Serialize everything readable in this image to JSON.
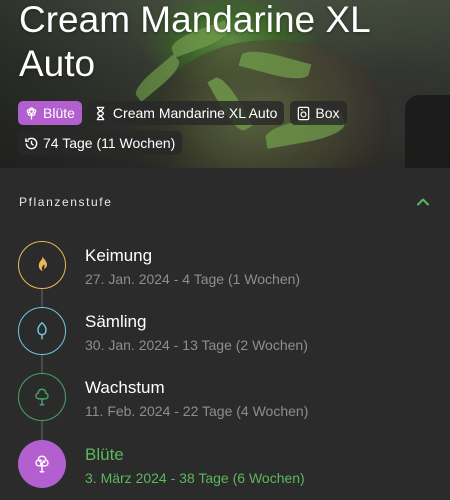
{
  "plant": {
    "title": "Cream Mandarine XL Auto",
    "chips": [
      {
        "label": "Blüte",
        "icon": "flower-icon",
        "accent": true
      },
      {
        "label": "Cream Mandarine XL Auto",
        "icon": "hourglass-icon",
        "accent": false
      },
      {
        "label": "Box",
        "icon": "box-icon",
        "accent": false
      },
      {
        "label": "74 Tage (11 Wochen)",
        "icon": "history-icon",
        "accent": false
      }
    ]
  },
  "stages_panel": {
    "title": "Pflanzenstufe",
    "stages": [
      {
        "name": "Keimung",
        "meta": "27. Jan. 2024 - 4 Tage (1 Wochen)",
        "icon": "flame-icon",
        "color": "#e8b85a"
      },
      {
        "name": "Sämling",
        "meta": "30. Jan. 2024 - 13 Tage (2 Wochen)",
        "icon": "seedling-leaf-icon",
        "color": "#6ec6e6"
      },
      {
        "name": "Wachstum",
        "meta": "11. Feb. 2024 - 22 Tage (4 Wochen)",
        "icon": "tree-icon",
        "color": "#4aa266"
      },
      {
        "name": "Blüte",
        "meta": "3. März 2024 - 38 Tage (6 Wochen)",
        "icon": "flowering-plant-icon",
        "color": "#b45fcf",
        "active": true
      }
    ]
  },
  "colors": {
    "accent_purple": "#b45fcf",
    "active_green": "#5cb85c",
    "background": "#2b2b2b"
  }
}
